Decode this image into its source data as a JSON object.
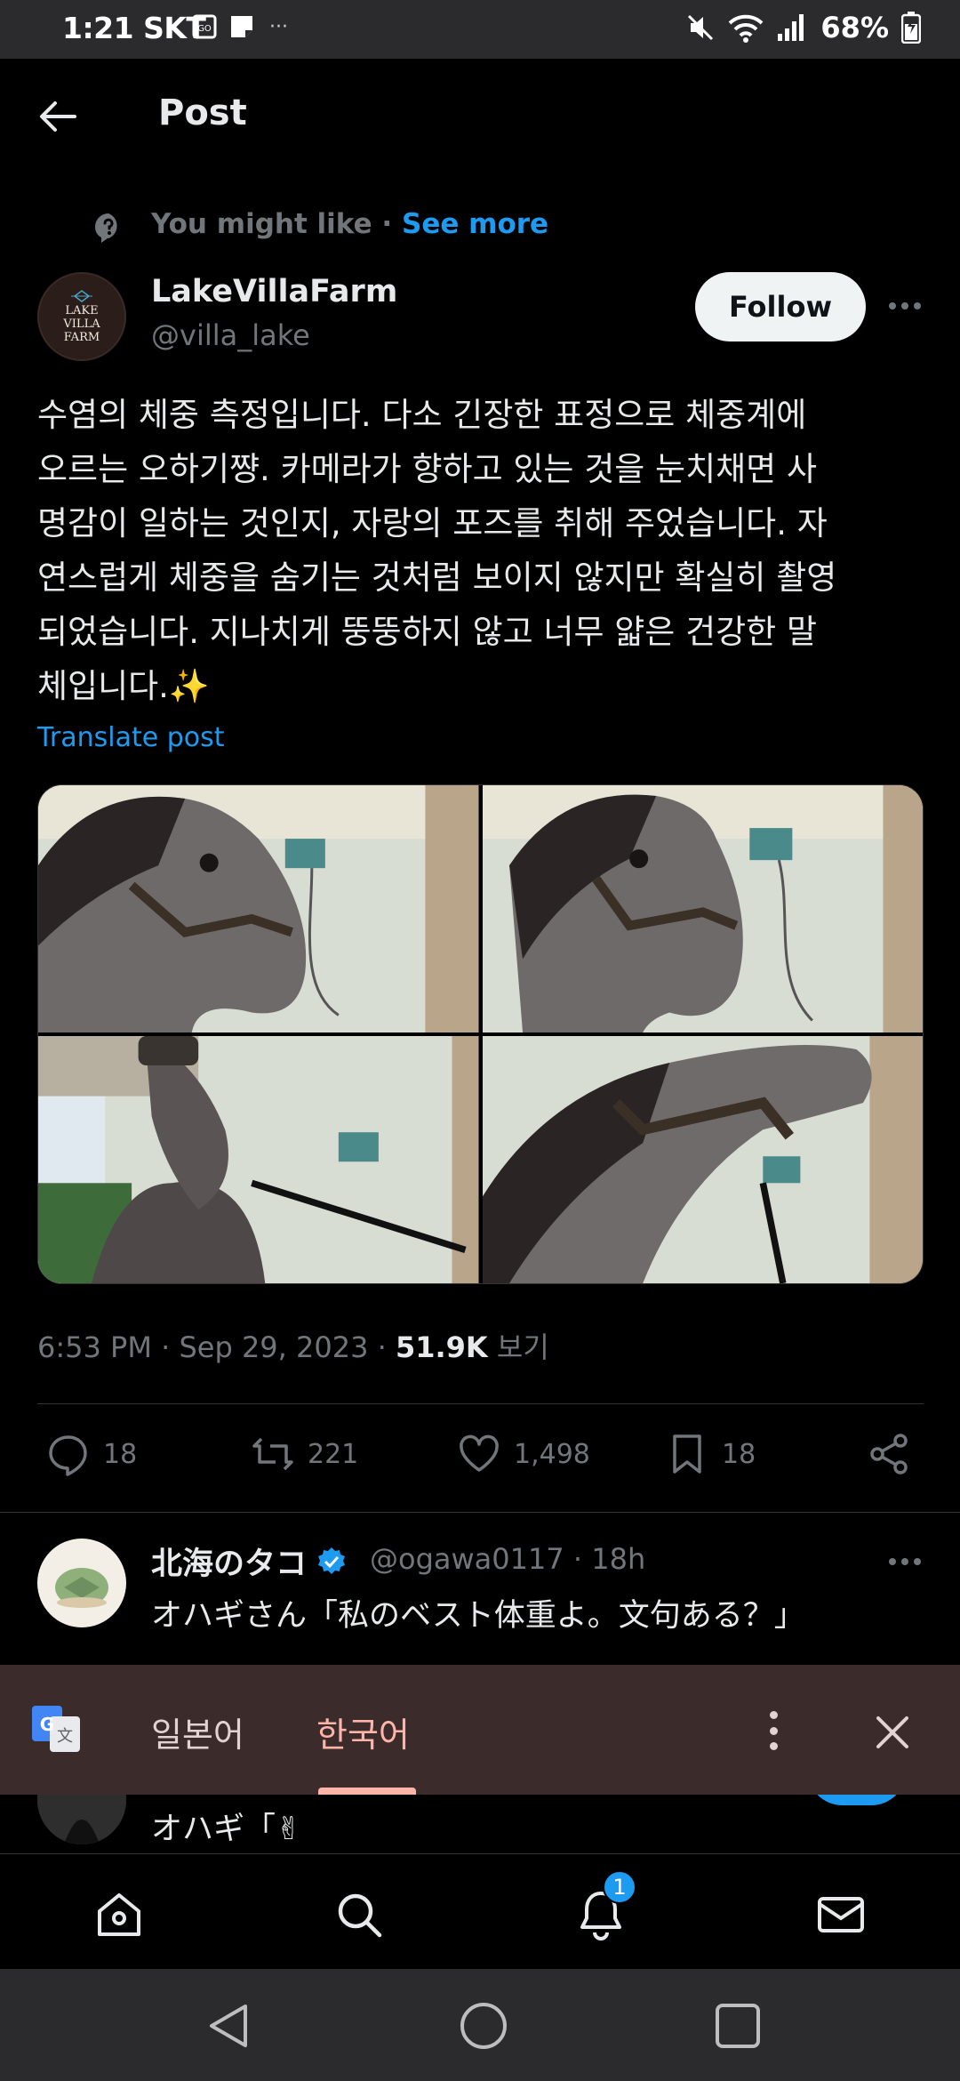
{
  "status_bar": {
    "time": "1:21",
    "carrier": "SKT",
    "battery": "68%",
    "more": "···"
  },
  "header": {
    "title": "Post"
  },
  "suggestion": {
    "label": "You might like",
    "separator": "·",
    "link": "See more"
  },
  "author": {
    "name": "LakeVillaFarm",
    "handle": "@villa_lake",
    "avatar_text": [
      "LAKE",
      "VILLA",
      "FARM"
    ],
    "follow_label": "Follow"
  },
  "post": {
    "text": "수염의 체중 측정입니다. 다소 긴장한 표정으로 체중계에\n오르는 오하기쨩. 카메라가 향하고 있는 것을 눈치채면 사\n명감이 일하는 것인지, 자랑의 포즈를 취해 주었습니다. 자\n연스럽게 체중을 숨기는 것처럼 보이지 않지만 확실히 촬영\n되었습니다. 지나치게 뚱뚱하지 않고 너무 얇은 건강한 말\n체입니다.✨",
    "translate_label": "Translate post",
    "time": "6:53 PM",
    "date": "Sep 29, 2023",
    "views": "51.9K",
    "views_label": "보기",
    "dot": "·"
  },
  "actions": {
    "replies": "18",
    "reposts": "221",
    "likes": "1,498",
    "bookmarks": "18"
  },
  "reply": {
    "name": "北海のタコ",
    "handle": "@ogawa0117",
    "dot": "·",
    "age": "18h",
    "text": "オハギさん「私のベスト体重よ。文句ある？」"
  },
  "translate_bar": {
    "source_lang": "일본어",
    "target_lang": "한국어"
  },
  "reply2": {
    "text": "オハギ「✌"
  },
  "bottom_nav": {
    "notification_badge": "1"
  },
  "colors": {
    "accent": "#1d9bf0",
    "background": "#000000",
    "muted": "#71767b",
    "text": "#e7e9ea",
    "translate_bar": "#3b2b2b",
    "translate_accent": "#ffb4a9"
  }
}
